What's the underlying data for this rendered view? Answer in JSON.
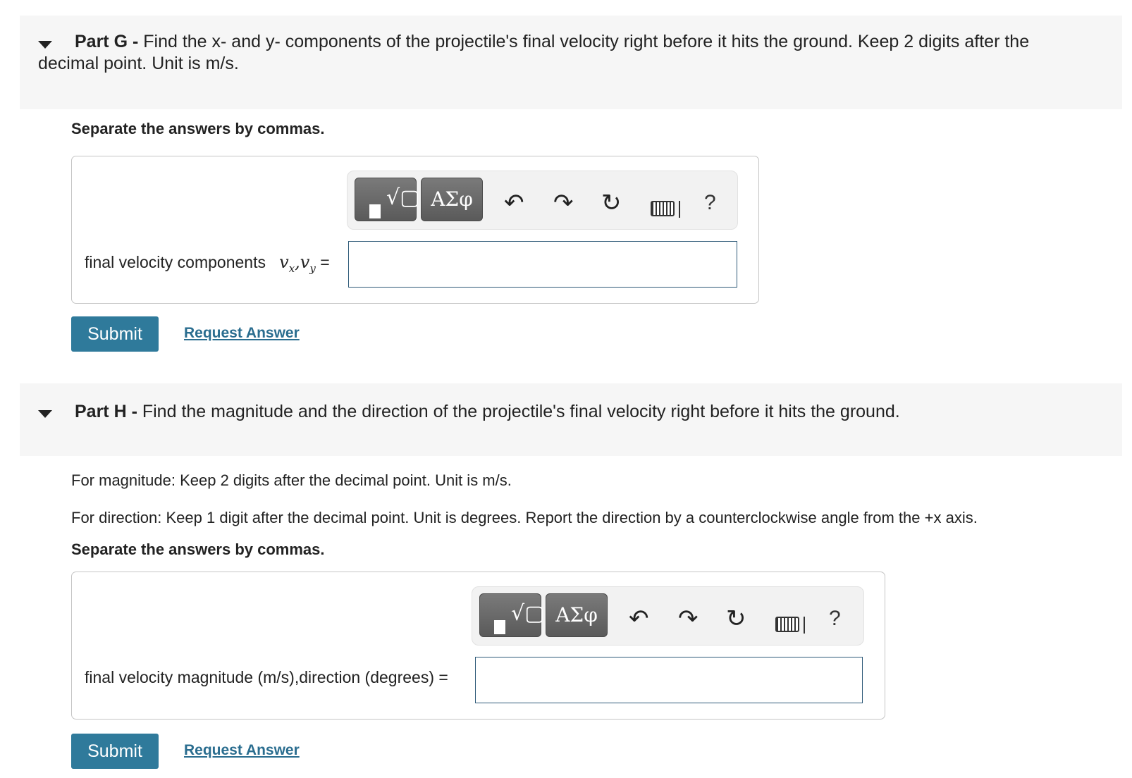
{
  "part_g": {
    "label": "Part G -",
    "prompt": "Find the x- and y- components of the projectile's final velocity right before it hits the ground. Keep 2 digits after the decimal point. Unit is m/s.",
    "instruction": "Separate the answers by commas.",
    "field_label": "final velocity components",
    "field_math": "vx,vy =",
    "input_value": "",
    "submit_label": "Submit",
    "request_label": "Request Answer"
  },
  "part_h": {
    "label": "Part H -",
    "prompt": "Find the magnitude and the direction of the projectile's final velocity right before it hits the ground.",
    "magnitude_instruction": "For magnitude: Keep 2 digits after the decimal point. Unit is m/s.",
    "direction_instruction": "For direction: Keep 1 digit after the decimal point. Unit is degrees. Report the direction by a counterclockwise angle from the +x axis.",
    "instruction": "Separate the answers by commas.",
    "field_label": "final velocity  magnitude (m/s),direction (degrees) =",
    "input_value": "",
    "submit_label": "Submit",
    "request_label": "Request Answer"
  },
  "toolbar": {
    "symbols_label": "ΑΣφ",
    "help_label": "?",
    "icons": [
      "templates-icon",
      "symbols-icon",
      "undo-icon",
      "redo-icon",
      "reset-icon",
      "keyboard-icon",
      "help-icon"
    ]
  },
  "colors": {
    "submit_bg": "#2f7a9b",
    "link": "#2a6d8f",
    "input_border": "#2e5a78",
    "header_bg": "#f6f6f6"
  }
}
